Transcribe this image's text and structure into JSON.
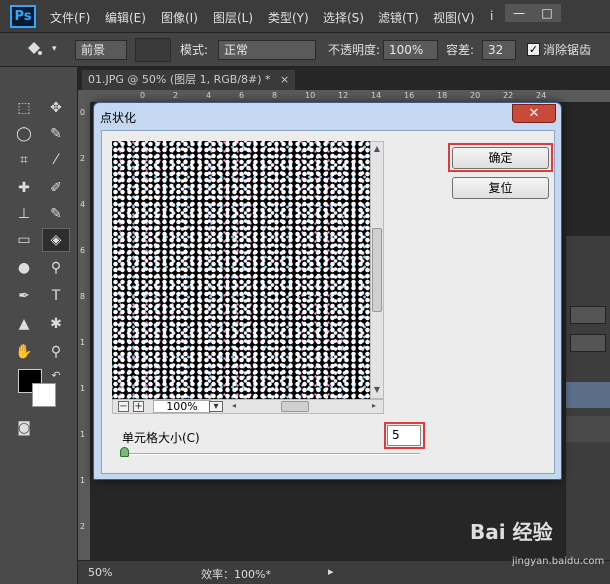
{
  "app": {
    "logo": "Ps"
  },
  "menu": [
    "文件(F)",
    "编辑(E)",
    "图像(I)",
    "图层(L)",
    "类型(Y)",
    "选择(S)",
    "滤镜(T)",
    "视图(V)",
    "i"
  ],
  "window_controls": {
    "minimize": "—",
    "maximize": "□"
  },
  "options_bar": {
    "brush_icon": "paint-bucket-icon",
    "fill_source": "前景",
    "mode_label": "模式:",
    "mode_value": "正常",
    "opacity_label": "不透明度:",
    "opacity_value": "100%",
    "tolerance_label": "容差:",
    "tolerance_value": "32",
    "antialias_label": "消除锯齿",
    "antialias_checked": true
  },
  "document": {
    "tab_label": "01.JPG @ 50% (图层 1, RGB/8#) *",
    "tab_close": "×"
  },
  "ruler": {
    "h_ticks": [
      "0",
      "2",
      "4",
      "6",
      "8",
      "10",
      "12",
      "14",
      "16",
      "18",
      "20",
      "22",
      "24"
    ],
    "v_ticks": [
      "0",
      "2",
      "4",
      "6",
      "8",
      "1",
      "1",
      "1",
      "1",
      "2"
    ]
  },
  "status": {
    "zoom": "50%",
    "efficiency": "效率：100%*"
  },
  "dialog": {
    "title": "点状化",
    "close": "✕",
    "ok_label": "确定",
    "reset_label": "复位",
    "zoom_out": "−",
    "zoom_in": "+",
    "zoom_value": "100%",
    "cell_size_label": "单元格大小(C)",
    "cell_size_value": "5",
    "cell_size_fraction": 0.0
  },
  "watermark": {
    "brand": "Bai 经验",
    "url": "jingyan.baidu.com"
  },
  "colors": {
    "accent": "#31a8ff",
    "highlight": "#e23a3a",
    "dialog_frame": "#c4d9f1"
  }
}
